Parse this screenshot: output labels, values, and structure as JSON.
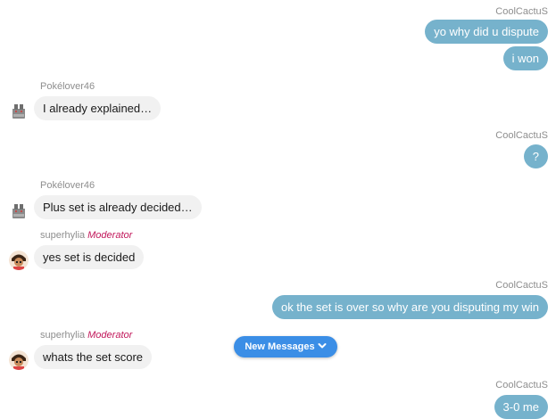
{
  "messages": [
    {
      "side": "right",
      "sender": "CoolCactuS",
      "texts": [
        "yo why did u dispute",
        "i won"
      ]
    },
    {
      "side": "left",
      "sender": "Pokélover46",
      "avatar": "bulbasaur-avatar",
      "texts": [
        "I already explained…"
      ]
    },
    {
      "side": "right",
      "sender": "CoolCactuS",
      "texts": [
        "?"
      ]
    },
    {
      "side": "left",
      "sender": "Pokélover46",
      "avatar": "bulbasaur-avatar",
      "texts": [
        "Plus set is already decided…"
      ]
    },
    {
      "side": "left",
      "sender": "superhylia",
      "role": "Moderator",
      "avatar": "character-avatar",
      "texts": [
        "yes set is decided"
      ]
    },
    {
      "side": "right",
      "sender": "CoolCactuS",
      "texts": [
        "ok the set is over so why are you disputing my win"
      ]
    },
    {
      "side": "left",
      "sender": "superhylia",
      "role": "Moderator",
      "avatar": "character-avatar",
      "texts": [
        "whats the set score"
      ]
    },
    {
      "side": "right",
      "sender": "CoolCactuS",
      "texts": [
        "3-0 me"
      ]
    }
  ],
  "new_messages_button": {
    "label": "New Messages",
    "icon": "chevron-down-icon"
  },
  "colors": {
    "own_bubble": "#76b2cc",
    "other_bubble": "#f1f1f1",
    "moderator_role": "#c2185b",
    "new_messages": "#3b8ee6"
  }
}
